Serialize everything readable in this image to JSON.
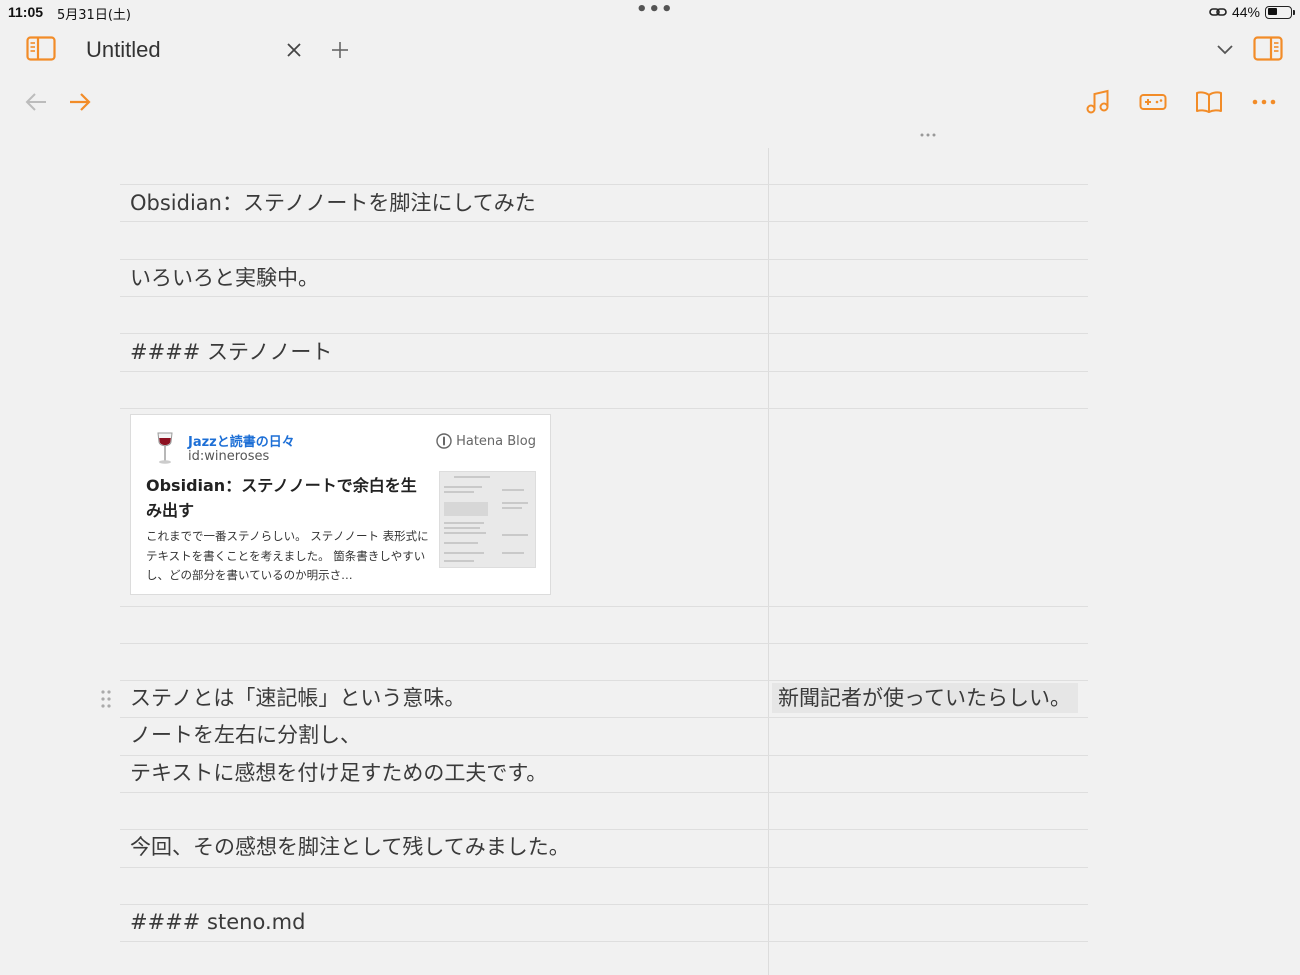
{
  "status_bar": {
    "time": "11:05",
    "date": "5月31日(土)",
    "battery_percent": "44%",
    "battery_level": 0.44
  },
  "tab": {
    "title": "Untitled"
  },
  "icons": {
    "sidebar_left": "sidebar-left-icon",
    "close": "close-icon",
    "new_tab": "plus-icon",
    "tab_list": "chevron-down-icon",
    "sidebar_right": "sidebar-right-icon",
    "back": "arrow-left-icon",
    "forward": "arrow-right-icon",
    "music": "music-note-icon",
    "game": "gamepad-icon",
    "reading": "book-open-icon",
    "more": "ellipsis-icon"
  },
  "colors": {
    "accent": "#f28c28",
    "background": "#f1f1f1",
    "link": "#1d6fd6"
  },
  "document": {
    "line1": "Obsidian：ステノノートを脚注にしてみた",
    "line2": "いろいろと実験中。",
    "line3": "#### ステノノート",
    "line4": "ステノとは「速記帳」という意味。",
    "line4_note": "新聞記者が使っていたらしい。",
    "line5": "ノートを左右に分割し、",
    "line6": "テキストに感想を付け足すための工夫です。",
    "line7": "今回、その感想を脚注として残してみました。",
    "line8": "#### steno.md"
  },
  "embed_card": {
    "blog_name": "Jazzと読書の日々",
    "blog_id": "id:wineroses",
    "brand": "Hatena Blog",
    "title": "Obsidian：ステノノートで余白を生み出す",
    "description": "これまでで一番ステノらしい。 ステノノート 表形式にテキストを書くことを考えました。 箇条書きしやすいし、どの部分を書いているのか明示さ…"
  }
}
